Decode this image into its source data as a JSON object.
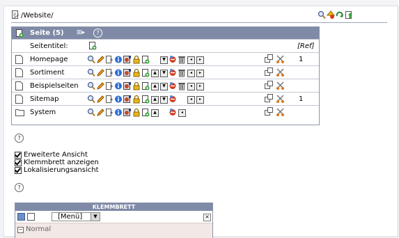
{
  "path": {
    "text": "/Website/"
  },
  "pages_panel": {
    "title": "Seite (5)",
    "subtitle_label": "Seitentitel:",
    "ref_label": "[Ref]",
    "rows": [
      {
        "name": "Homepage",
        "count": "1",
        "type": "page"
      },
      {
        "name": "Sortiment",
        "count": "",
        "type": "page"
      },
      {
        "name": "Beispielseiten",
        "count": "",
        "type": "page"
      },
      {
        "name": "Sitemap",
        "count": "1",
        "type": "page"
      },
      {
        "name": "System",
        "count": "",
        "type": "folder"
      }
    ]
  },
  "options": [
    {
      "label": "Erweiterte Ansicht",
      "checked": true
    },
    {
      "label": "Klemmbrett anzeigen",
      "checked": true
    },
    {
      "label": "Lokalisierungsansicht",
      "checked": true
    }
  ],
  "clipboard": {
    "title": "KLEMMBRETT",
    "menu_value": "[Menü]",
    "section_label": "Normal"
  }
}
